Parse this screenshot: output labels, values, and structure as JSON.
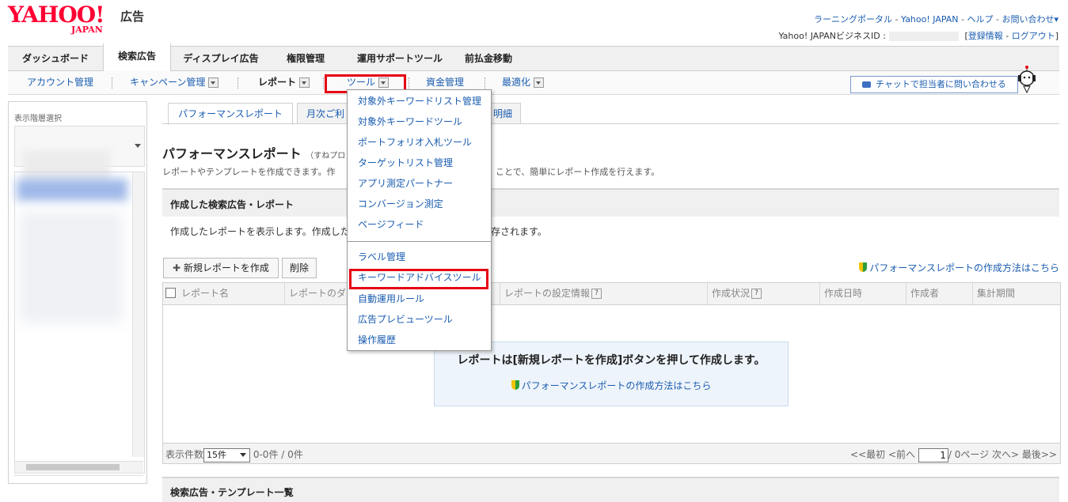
{
  "header": {
    "logo_yahoo": "YAHOO!",
    "logo_japan": "JAPAN",
    "logo_product": "広告",
    "top_links": [
      "ラーニングポータル",
      "Yahoo! JAPAN",
      "ヘルプ",
      "お問い合わせ▾"
    ],
    "business_id_label": "Yahoo! JAPANビジネスID :",
    "account_links": [
      "登録情報",
      "ログアウト"
    ]
  },
  "main_tabs": [
    "ダッシュボード",
    "検索広告",
    "ディスプレイ広告",
    "権限管理",
    "運用サポートツール",
    "前払金移動"
  ],
  "sub_nav": {
    "items": [
      "アカウント管理",
      "キャンペーン管理",
      "レポート",
      "ツール",
      "資金管理",
      "最適化"
    ],
    "chat_button": "チャットで担当者に問い合わせる"
  },
  "left_panel": {
    "title": "表示階層選択"
  },
  "report_tabs": [
    "パフォーマンスレポート",
    "月次ご利",
    "明細"
  ],
  "page": {
    "title": "パフォーマンスレポート",
    "title_note": "（すねプロ",
    "description": "レポートやテンプレートを作成できます。作",
    "description_tail": "ことで、簡単にレポート作成を行えます。",
    "section_title": "作成した検索広告・レポート",
    "section_desc": "作成したレポートを表示します。作成した",
    "section_desc_tail": "存されます。",
    "new_report_button": "新規レポートを作成",
    "delete_button": "削除",
    "howto_link": "パフォーマンスレポートの作成方法はこちら",
    "columns": [
      "レポート名",
      "レポートのダウ",
      "レポートの設定情報",
      "作成状況",
      "作成日時",
      "作成者",
      "集計期間"
    ],
    "empty_message": "レポートは[新規レポートを作成]ボタンを押して作成します。",
    "empty_link": "パフォーマンスレポートの作成方法はこちら",
    "pager_label": "表示件数",
    "pager_select": "15件",
    "pager_count": "0-0件 / 0件",
    "pager_first": "<<最初",
    "pager_prev": "<前へ",
    "pager_page": "1",
    "pager_total": "/ 0ページ",
    "pager_next": "次へ>",
    "pager_last": "最後>>",
    "template_section_title": "検索広告・テンプレート一覧"
  },
  "tools_menu": {
    "items_top": [
      "対象外キーワードリスト管理",
      "対象外キーワードツール",
      "ポートフォリオ入札ツール",
      "ターゲットリスト管理",
      "アプリ測定パートナー",
      "コンバージョン測定",
      "ページフィード"
    ],
    "items_bottom": [
      "ラベル管理",
      "キーワードアドバイスツール",
      "自動運用ルール",
      "広告プレビューツール",
      "操作履歴"
    ]
  },
  "colors": {
    "link": "#1a5cb0",
    "highlight": "#e60012",
    "brand": "#ff0033"
  }
}
